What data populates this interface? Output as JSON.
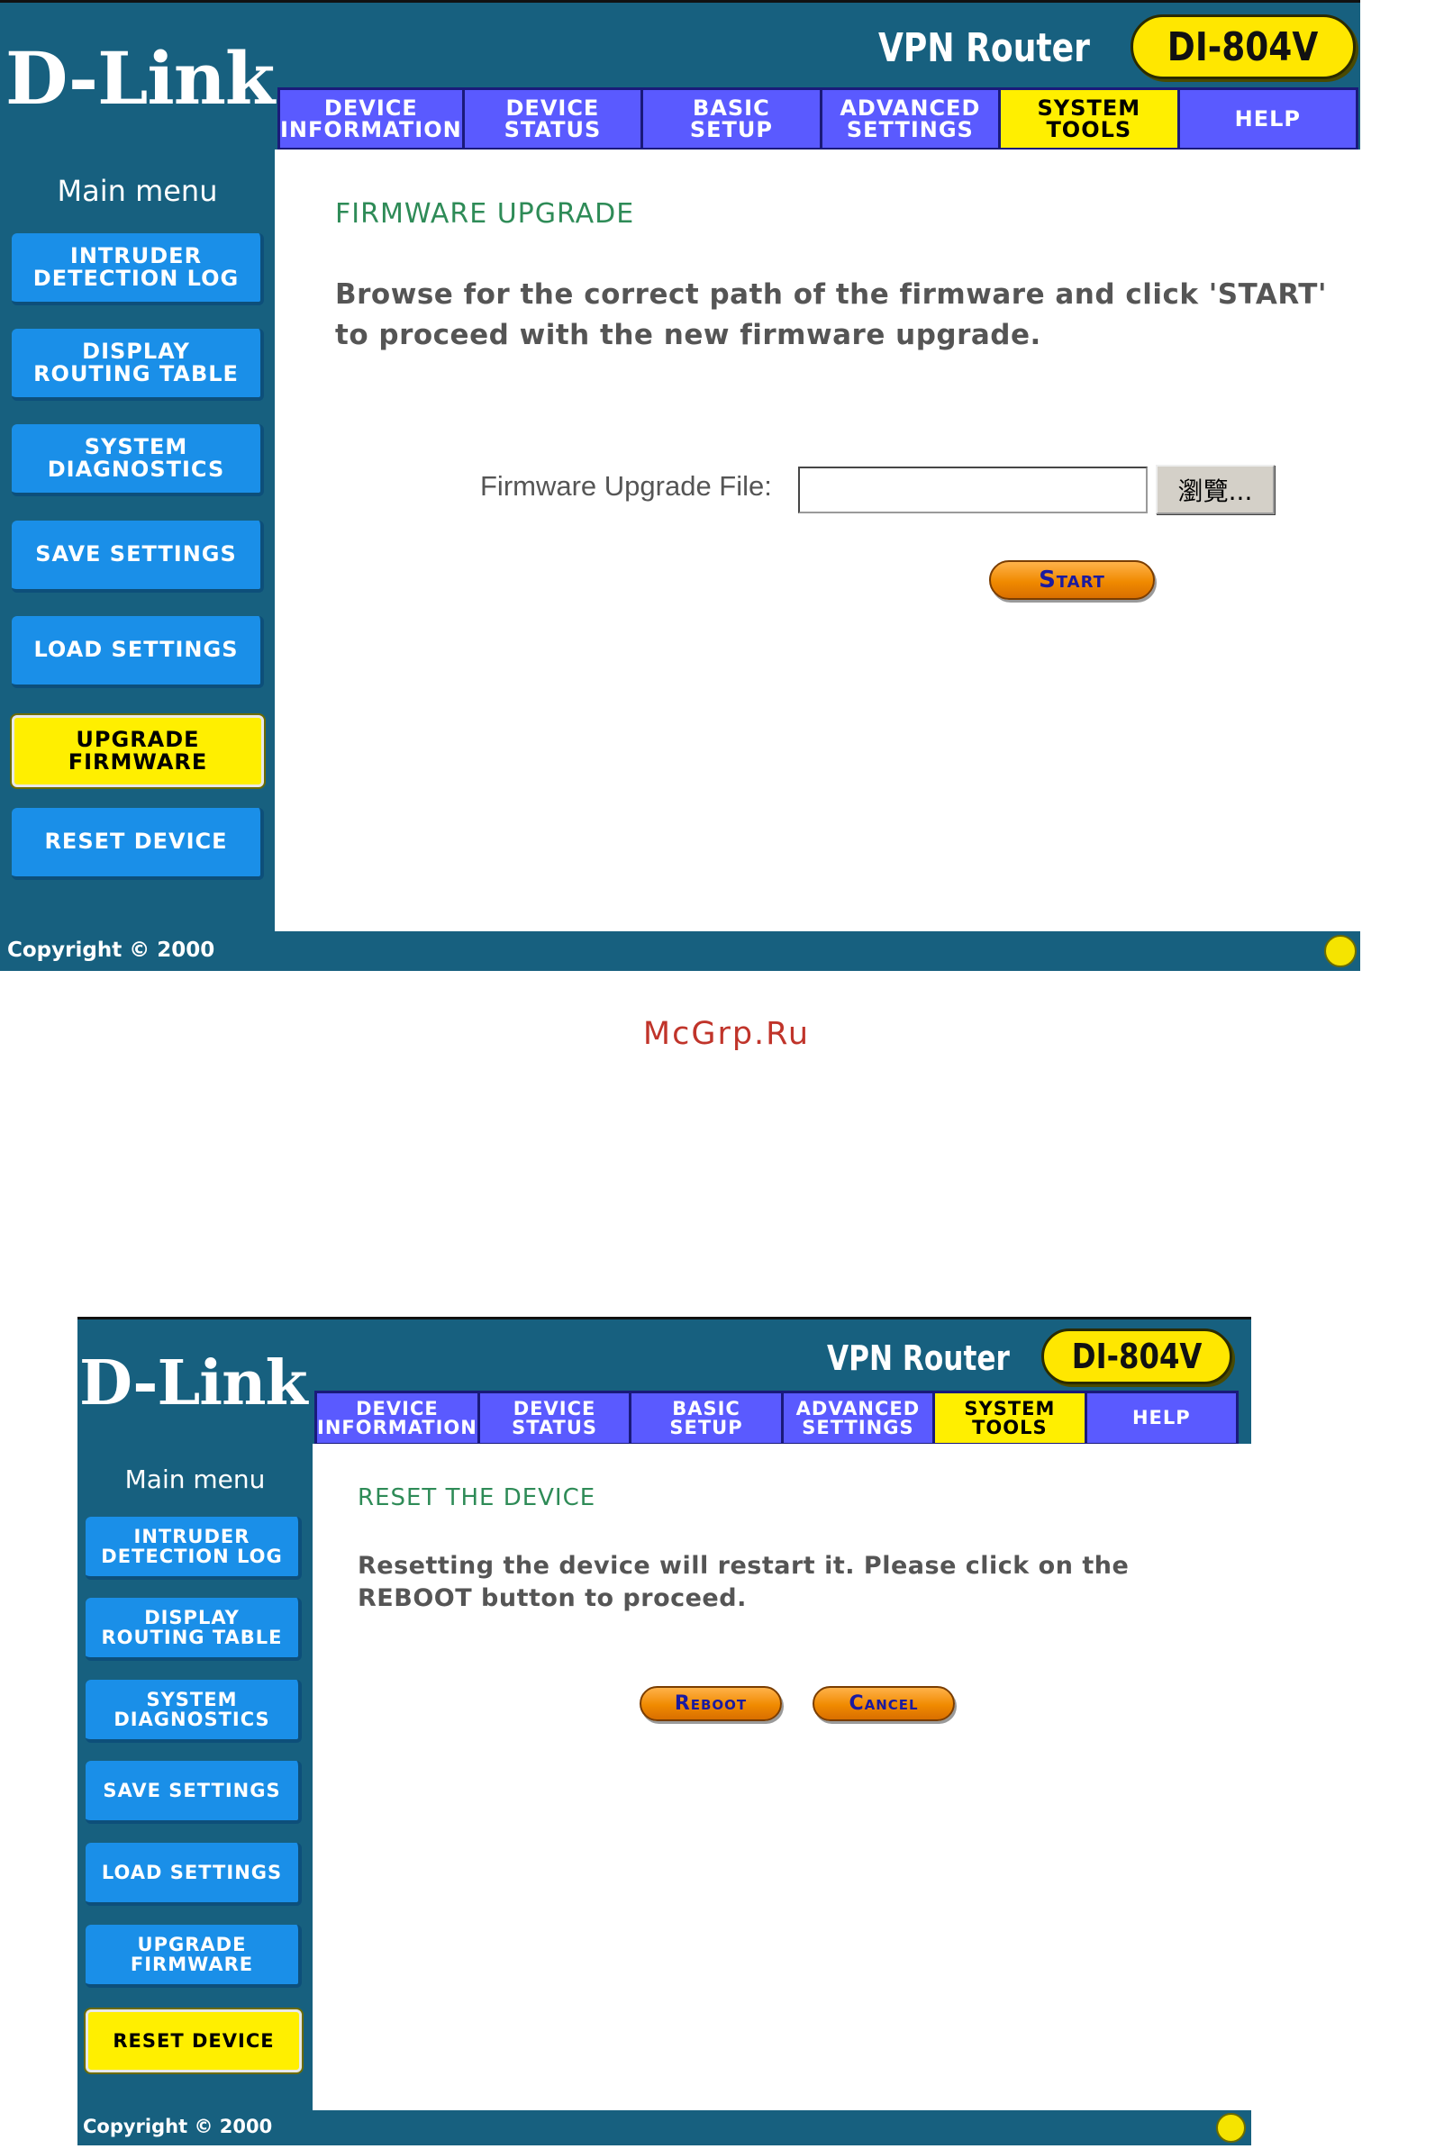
{
  "screen1": {
    "brand": {
      "logo": "D-Link",
      "product": "VPN Router",
      "model": "DI-804V"
    },
    "tabs": [
      {
        "label": "DEVICE\nINFORMATION",
        "active": false
      },
      {
        "label": "DEVICE\nSTATUS",
        "active": false
      },
      {
        "label": "BASIC\nSETUP",
        "active": false
      },
      {
        "label": "ADVANCED\nSETTINGS",
        "active": false
      },
      {
        "label": "SYSTEM\nTOOLS",
        "active": true
      },
      {
        "label": "HELP",
        "active": false
      }
    ],
    "menu_title": "Main menu",
    "menu": [
      {
        "label": "INTRUDER\nDETECTION LOG",
        "active": false
      },
      {
        "label": "DISPLAY\nROUTING TABLE",
        "active": false
      },
      {
        "label": "SYSTEM\nDIAGNOSTICS",
        "active": false
      },
      {
        "label": "SAVE SETTINGS",
        "active": false
      },
      {
        "label": "LOAD SETTINGS",
        "active": false
      },
      {
        "label": "UPGRADE\nFIRMWARE",
        "active": true
      },
      {
        "label": "RESET DEVICE",
        "active": false
      }
    ],
    "heading": "FIRMWARE UPGRADE",
    "instructions": "Browse for the correct path of the firmware and click 'START' to proceed with the new firmware upgrade.",
    "file_label": "Firmware Upgrade File:",
    "file_value": "",
    "browse_label": "瀏覽...",
    "start_label": "Start",
    "copyright": "Copyright © 2000"
  },
  "watermark": "McGrp.Ru",
  "screen2": {
    "brand": {
      "logo": "D-Link",
      "product": "VPN Router",
      "model": "DI-804V"
    },
    "tabs": [
      {
        "label": "DEVICE\nINFORMATION",
        "active": false
      },
      {
        "label": "DEVICE\nSTATUS",
        "active": false
      },
      {
        "label": "BASIC\nSETUP",
        "active": false
      },
      {
        "label": "ADVANCED\nSETTINGS",
        "active": false
      },
      {
        "label": "SYSTEM\nTOOLS",
        "active": true
      },
      {
        "label": "HELP",
        "active": false
      }
    ],
    "menu_title": "Main menu",
    "menu": [
      {
        "label": "INTRUDER\nDETECTION LOG",
        "active": false
      },
      {
        "label": "DISPLAY\nROUTING TABLE",
        "active": false
      },
      {
        "label": "SYSTEM\nDIAGNOSTICS",
        "active": false
      },
      {
        "label": "SAVE SETTINGS",
        "active": false
      },
      {
        "label": "LOAD SETTINGS",
        "active": false
      },
      {
        "label": "UPGRADE\nFIRMWARE",
        "active": false
      },
      {
        "label": "RESET DEVICE",
        "active": true
      }
    ],
    "heading": "RESET THE DEVICE",
    "instructions": "Resetting the device will restart it. Please click on the REBOOT button to proceed.",
    "reboot_label": "Reboot",
    "cancel_label": "Cancel",
    "copyright": "Copyright © 2000"
  },
  "colors": {
    "panel": "#17607f",
    "tab": "#5a5aff",
    "active_highlight": "#ffef00",
    "side_button": "#1a8fe8",
    "heading_green": "#2e8b57",
    "action_orange": "#f08a00"
  }
}
